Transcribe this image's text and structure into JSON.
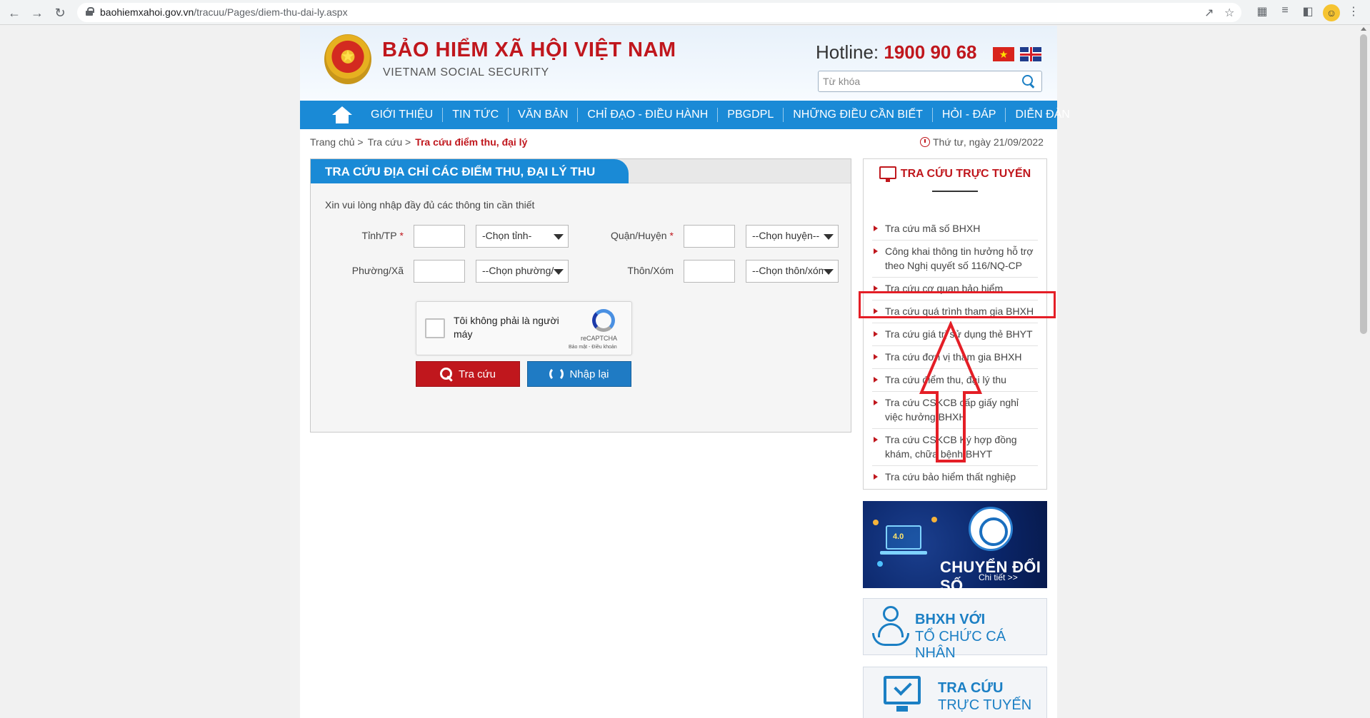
{
  "browser": {
    "url_host": "baohiemxahoi.gov.vn",
    "url_path": "/tracuu/Pages/diem-thu-dai-ly.aspx",
    "icons": [
      "back-icon",
      "forward-icon",
      "reload-icon",
      "lock-icon",
      "share-icon",
      "star-icon",
      "puzzle-icon",
      "reading-list-icon",
      "sidebar-icon",
      "profile-icon",
      "kebab-menu-icon"
    ]
  },
  "header": {
    "title": "BẢO HIỂM XÃ HỘI VIỆT NAM",
    "subtitle": "VIETNAM SOCIAL SECURITY",
    "hotline_label": "Hotline: ",
    "hotline_number": "1900 90 68",
    "search_placeholder": "Từ khóa"
  },
  "nav": {
    "items": [
      "GIỚI THIỆU",
      "TIN TỨC",
      "VĂN BẢN",
      "CHỈ ĐẠO - ĐIỀU HÀNH",
      "PBGDPL",
      "NHỮNG ĐIỀU CẦN BIẾT",
      "HỎI - ĐÁP",
      "DIỄN ĐÀN"
    ]
  },
  "breadcrumb": {
    "home": "Trang chủ >",
    "lookup": "Tra cứu >",
    "current": "Tra cứu điểm thu, đại lý"
  },
  "date": "Thứ tư, ngày 21/09/2022",
  "form": {
    "title": "TRA CỨU ĐỊA CHỈ CÁC ĐIỂM THU, ĐẠI LÝ THU",
    "note": "Xin vui lòng nhập đầy đủ các thông tin cần thiết",
    "province_label": "Tỉnh/TP",
    "district_label": "Quận/Huyện",
    "ward_label": "Phường/Xã",
    "village_label": "Thôn/Xóm",
    "required_mark": "*",
    "province_select": "-Chọn tỉnh-",
    "district_select": "--Chọn huyện--",
    "ward_select": "--Chọn phường/",
    "village_select": "--Chọn thôn/xóm",
    "captcha_text": "Tôi không phải là người máy",
    "captcha_brand": "reCAPTCHA",
    "captcha_links": "Bảo mật - Điều khoản",
    "search_button": "Tra cứu",
    "reset_button": "Nhập lại"
  },
  "sidebar": {
    "title": "TRA CỨU TRỰC TUYẾN",
    "items": [
      "Tra cứu mã số BHXH",
      "Công khai thông tin hưởng hỗ trợ theo Nghị quyết số 116/NQ-CP",
      "Tra cứu cơ quan bảo hiểm",
      "Tra cứu quá trình tham gia BHXH",
      "Tra cứu giá trị sử dụng thẻ BHYT",
      "Tra cứu đơn vị tham gia BHXH",
      "Tra cứu điểm thu, đại lý thu",
      "Tra cứu CSKCB cấp giấy nghỉ việc hưởng BHXH",
      "Tra cứu CSKCB Ký hợp đồng khám, chữa bệnh BHYT",
      "Tra cứu bảo hiểm thất nghiệp"
    ]
  },
  "banners": {
    "digital_label40": "4.0",
    "digital_title": "CHUYỂN ĐỔI SỐ",
    "digital_more": "Chi tiết >>",
    "bhxh_line1": "BHXH VỚI",
    "bhxh_line2": "TỔ CHỨC CÁ NHÂN",
    "tc_line1": "TRA CỨU",
    "tc_line2": "TRỰC TUYẾN"
  },
  "colors": {
    "brand_red": "#c0171d",
    "nav_blue": "#1a8ad6",
    "annotation_red": "#e41e26"
  }
}
